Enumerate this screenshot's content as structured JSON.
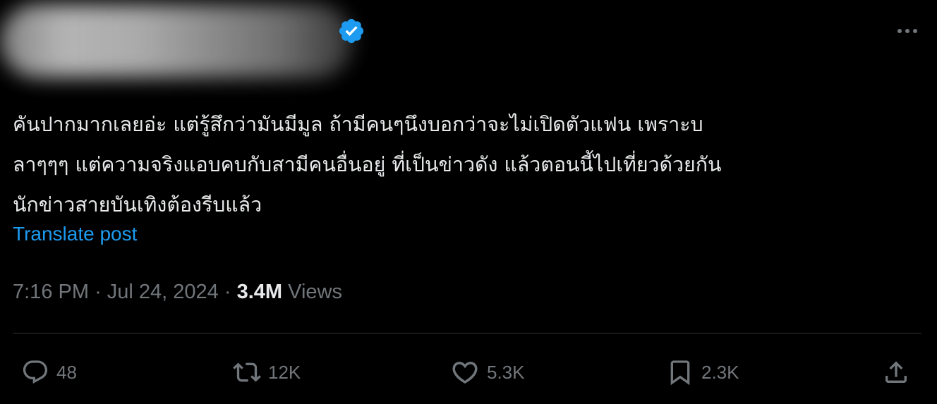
{
  "post": {
    "text_lines": [
      "คันปากมากเลยอ่ะ แต่รู้สึกว่ามันมีมูล ถ้ามีคนๆนึงบอกว่าจะไม่เปิดตัวแฟน เพราะบ",
      "ลาๆๆๆ แต่ความจริงแอบคบกับสามีคนอื่นอยู่ ที่เป็นข่าวดัง แล้วตอนนี้ไปเที่ยวด้วยกัน",
      "นักข่าวสายบันเทิงต้องรีบแล้ว"
    ],
    "translate_label": "Translate post",
    "time": "7:16 PM",
    "separator": "·",
    "date": "Jul 24, 2024",
    "views_count": "3.4M",
    "views_label": "Views"
  },
  "actions": {
    "replies": "48",
    "reposts": "12K",
    "likes": "5.3K",
    "bookmarks": "2.3K"
  },
  "icons": {
    "verified": "verified-badge-icon",
    "more": "more-icon",
    "reply": "reply-icon",
    "repost": "repost-icon",
    "like": "heart-icon",
    "bookmark": "bookmark-icon",
    "share": "share-icon"
  },
  "colors": {
    "background": "#000000",
    "text": "#e7e9ea",
    "muted": "#71767b",
    "accent": "#1d9bf0",
    "divider": "#2f3336"
  }
}
